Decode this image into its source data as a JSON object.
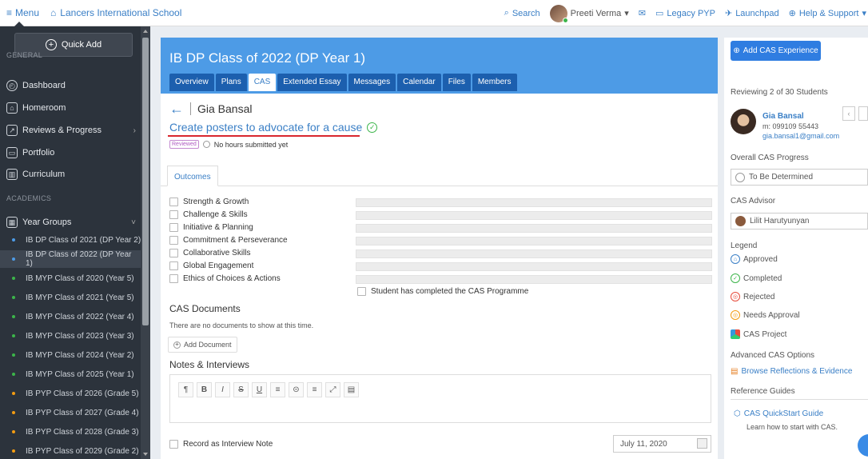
{
  "topbar": {
    "menu_label": "Menu",
    "school": "Lancers International School",
    "search": "Search",
    "user": "Preeti Verma",
    "legacy": "Legacy PYP",
    "launchpad": "Launchpad",
    "help": "Help & Support"
  },
  "sidebar": {
    "quick_add": "Quick Add",
    "general_label": "GENERAL",
    "general_items": [
      "Dashboard",
      "Homeroom",
      "Reviews & Progress",
      "Portfolio",
      "Curriculum"
    ],
    "academics_label": "ACADEMICS",
    "year_groups": "Year Groups",
    "groups": [
      {
        "label": "IB DP Class of 2021 (DP Year 2)",
        "color": "#4d9be6"
      },
      {
        "label": "IB DP Class of 2022 (DP Year 1)",
        "color": "#4d9be6"
      },
      {
        "label": "IB MYP Class of 2020 (Year 5)",
        "color": "#3cb54a"
      },
      {
        "label": "IB MYP Class of 2021 (Year 5)",
        "color": "#3cb54a"
      },
      {
        "label": "IB MYP Class of 2022 (Year 4)",
        "color": "#3cb54a"
      },
      {
        "label": "IB MYP Class of 2023 (Year 3)",
        "color": "#3cb54a"
      },
      {
        "label": "IB MYP Class of 2024 (Year 2)",
        "color": "#3cb54a"
      },
      {
        "label": "IB MYP Class of 2025 (Year 1)",
        "color": "#3cb54a"
      },
      {
        "label": "IB PYP Class of 2026 (Grade 5)",
        "color": "#f39c12"
      },
      {
        "label": "IB PYP Class of 2027 (Grade 4)",
        "color": "#f39c12"
      },
      {
        "label": "IB PYP Class of 2028 (Grade 3)",
        "color": "#f39c12"
      },
      {
        "label": "IB PYP Class of 2029 (Grade 2)",
        "color": "#f39c12"
      }
    ]
  },
  "main": {
    "title": "IB DP Class of 2022 (DP Year 1)",
    "tabs": [
      "Overview",
      "Plans",
      "CAS",
      "Extended Essay",
      "Messages",
      "Calendar",
      "Files",
      "Members"
    ],
    "student": "Gia Bansal",
    "experience": "Create posters to advocate for a cause",
    "reviewed": "Reviewed",
    "hours": "No hours submitted yet",
    "outcomes_tab": "Outcomes",
    "outcomes": [
      "Strength & Growth",
      "Challenge & Skills",
      "Initiative & Planning",
      "Commitment & Perseverance",
      "Collaborative Skills",
      "Global Engagement",
      "Ethics of Choices & Actions"
    ],
    "completed": "Student has completed the CAS Programme",
    "docs_title": "CAS Documents",
    "docs_empty": "There are no documents to show at this time.",
    "add_doc": "Add Document",
    "notes_title": "Notes & Interviews",
    "toolbar": [
      "¶",
      "B",
      "I",
      "S",
      "U",
      "≡",
      "⊝",
      "≡",
      "⤢",
      "▤"
    ],
    "record": "Record as Interview Note",
    "date": "July 11, 2020"
  },
  "right": {
    "add_cas": "Add CAS Experience",
    "reviewing": "Reviewing 2 of 30 Students",
    "student_name": "Gia Bansal",
    "mobile": "m: 099109 55443",
    "email": "gia.bansal1@gmail.com",
    "progress_label": "Overall CAS Progress",
    "progress_value": "To Be Determined",
    "advisor_label": "CAS Advisor",
    "advisor": "Lilit Harutyunyan",
    "legend_label": "Legend",
    "legend": [
      "Approved",
      "Completed",
      "Rejected",
      "Needs Approval",
      "CAS Project"
    ],
    "advanced_label": "Advanced CAS Options",
    "browse": "Browse Reflections & Evidence",
    "ref_label": "Reference Guides",
    "guide": "CAS QuickStart Guide",
    "guide_sub": "Learn how to start with CAS."
  }
}
